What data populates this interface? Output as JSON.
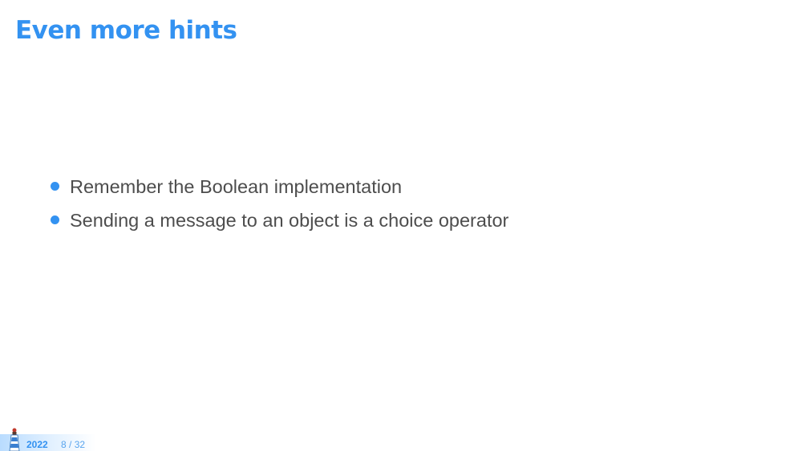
{
  "slide": {
    "title": "Even more hints",
    "bullets": [
      "Remember the Boolean implementation",
      "Sending a message to an object is a choice operator"
    ]
  },
  "footer": {
    "year": "2022",
    "page_current": "8",
    "page_separator": "/",
    "page_total": "32",
    "logo_icon": "lighthouse-icon"
  },
  "colors": {
    "title": "#3392f1",
    "bullet": "#3392f1",
    "body_text": "#4d4d4d",
    "footer_year": "#3392f1",
    "footer_page": "#5aa5ee"
  }
}
